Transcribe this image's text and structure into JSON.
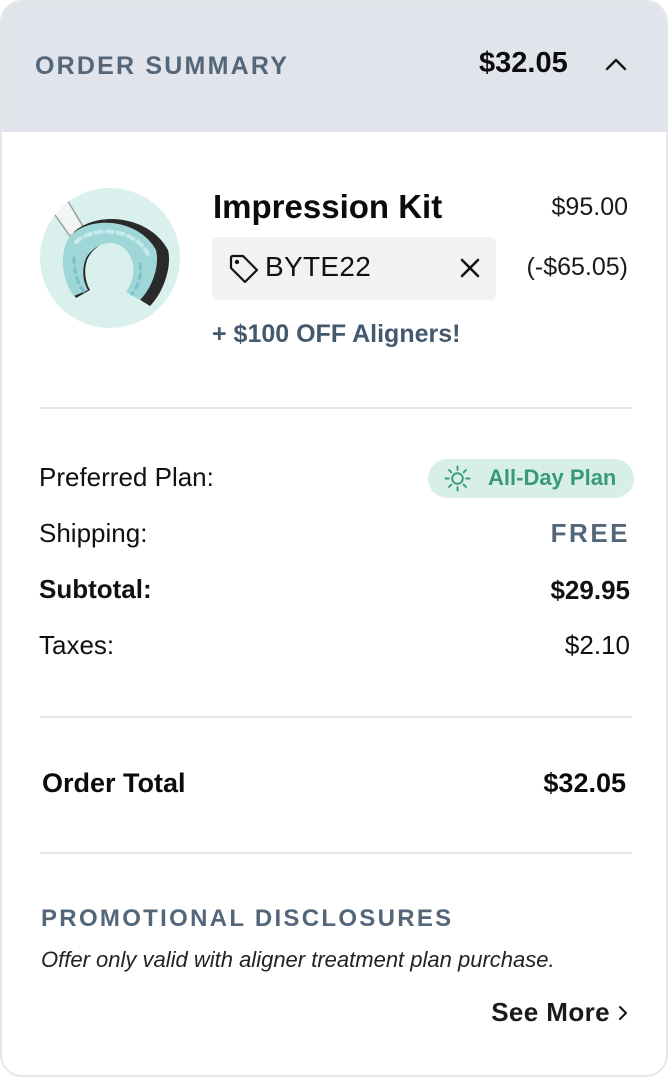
{
  "header": {
    "title": "ORDER SUMMARY",
    "total": "$32.05",
    "background": "#e1e5eb"
  },
  "product": {
    "name": "Impression Kit",
    "price": "$95.00",
    "image_icon": "impression-tray-image",
    "promo_code": "BYTE22",
    "discount": "(-$65.05)",
    "promo_banner": "+ $100 OFF Aligners!"
  },
  "summary": {
    "plan_label": "Preferred Plan:",
    "plan_value": "All-Day Plan",
    "plan_icon": "sun-icon",
    "shipping_label": "Shipping:",
    "shipping_value": "FREE",
    "subtotal_label": "Subtotal:",
    "subtotal_value": "$29.95",
    "taxes_label": "Taxes:",
    "taxes_value": "$2.10"
  },
  "total": {
    "label": "Order Total",
    "value": "$32.05"
  },
  "disclosures": {
    "title": "PROMOTIONAL DISCLOSURES",
    "text": "Offer only valid with aligner treatment plan purchase.",
    "see_more": "See More"
  },
  "colors": {
    "accent_slate": "#54677a",
    "plan_green": "#3a9a78",
    "plan_pill_bg": "#d8efe7",
    "product_circle_bg": "#d9f0ec"
  }
}
